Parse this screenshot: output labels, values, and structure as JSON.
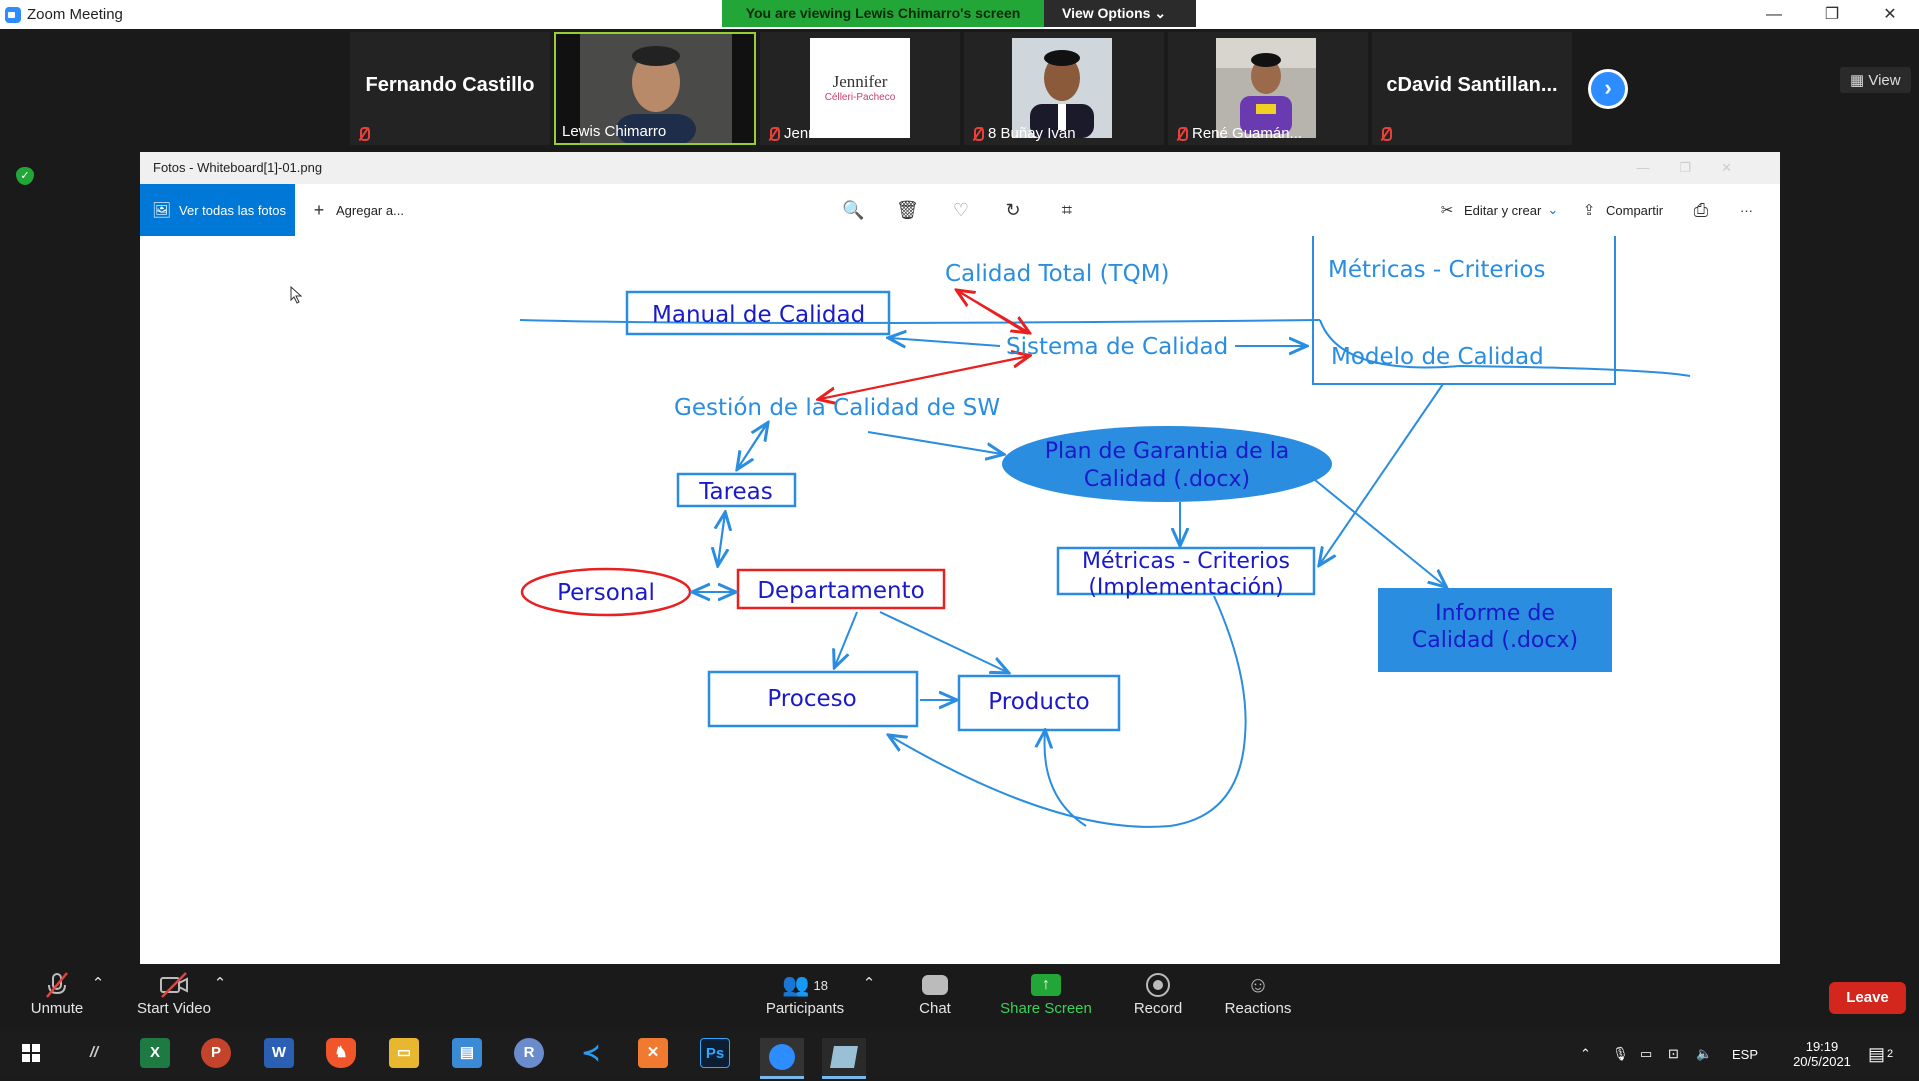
{
  "window": {
    "title": "Zoom Meeting",
    "controls": [
      "—",
      "❐",
      "✕"
    ]
  },
  "banner": {
    "viewing_text": "You are viewing Lewis Chimarro's screen",
    "view_options": "View Options"
  },
  "participants": [
    {
      "name": "Fernando Castillo",
      "label": "",
      "type": "name"
    },
    {
      "name": "",
      "label": "Lewis Chimarro",
      "type": "video"
    },
    {
      "name": "",
      "label": "Jennifer Céller...",
      "type": "logo",
      "logo_main": "Jennifer",
      "logo_sub": "Célleri-Pacheco"
    },
    {
      "name": "",
      "label": "8 Buñay Ivan",
      "type": "photo"
    },
    {
      "name": "",
      "label": "René Guamán...",
      "type": "photo"
    },
    {
      "name": "cDavid  Santillan...",
      "label": "",
      "type": "name"
    }
  ],
  "view_button": "View",
  "photos_app": {
    "title": "Fotos - Whiteboard[1]-01.png",
    "btn_all": "Ver todas las fotos",
    "btn_add": "Agregar a...",
    "btn_edit": "Editar y crear",
    "btn_share": "Compartir",
    "btn_more": "···"
  },
  "diagram": {
    "tqm": "Calidad Total (TQM)",
    "manual": "Manual de Calidad",
    "sistema": "Sistema de Calidad",
    "metricas_top": "Métricas - Criterios",
    "modelo": "Modelo de Calidad",
    "gestion": "Gestión de la Calidad de SW",
    "plan_1": "Plan de Garantia de la",
    "plan_2": "Calidad (.docx)",
    "tareas": "Tareas",
    "metricas_impl_1": "Métricas - Criterios",
    "metricas_impl_2": "(Implementación)",
    "personal": "Personal",
    "departamento": "Departamento",
    "informe_1": "Informe de",
    "informe_2": "Calidad (.docx)",
    "proceso": "Proceso",
    "producto": "Producto"
  },
  "controls": {
    "unmute": "Unmute",
    "start_video": "Start Video",
    "participants": "Participants",
    "participants_count": "18",
    "chat": "Chat",
    "share_screen": "Share Screen",
    "record": "Record",
    "reactions": "Reactions",
    "leave": "Leave"
  },
  "taskbar": {
    "language": "ESP",
    "time": "19:19",
    "date": "20/5/2021",
    "notification_count": "2"
  },
  "colors": {
    "zoom_blue": "#2d8cff",
    "banner_green": "#23a638",
    "photos_blue": "#0078d7",
    "leave_red": "#d3261d",
    "diagram_text": "#2a8de0",
    "diagram_dark": "#1a1ac8",
    "diagram_red": "#e82020"
  }
}
